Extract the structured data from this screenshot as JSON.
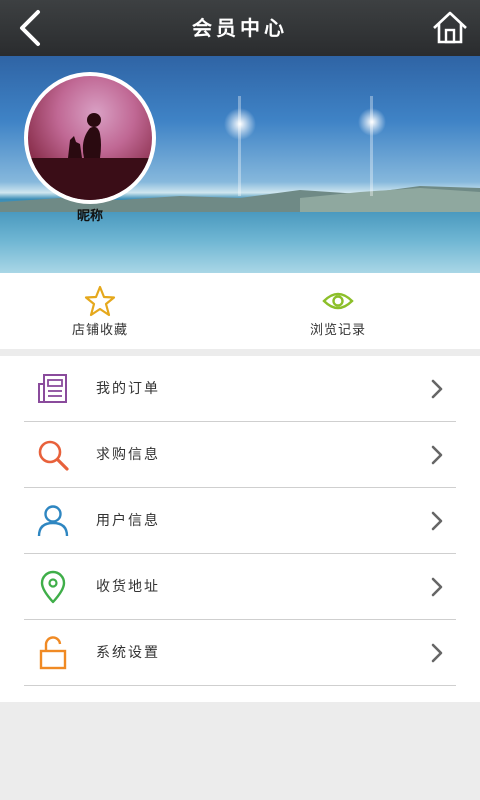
{
  "header": {
    "title": "会员中心",
    "back_icon": "chevron-left-icon",
    "home_icon": "home-icon"
  },
  "profile": {
    "nickname": "昵称"
  },
  "quick_actions": [
    {
      "label": "店铺收藏",
      "icon": "star-icon",
      "color": "#e5a81c"
    },
    {
      "label": "浏览记录",
      "icon": "eye-icon",
      "color": "#8cbf2a"
    }
  ],
  "menu": [
    {
      "label": "我的订单",
      "icon": "newspaper-icon",
      "color": "#8a4b9c"
    },
    {
      "label": "求购信息",
      "icon": "magnifier-icon",
      "color": "#e8613b"
    },
    {
      "label": "用户信息",
      "icon": "user-icon",
      "color": "#2e86c1"
    },
    {
      "label": "收货地址",
      "icon": "location-pin-icon",
      "color": "#3fae49"
    },
    {
      "label": "系统设置",
      "icon": "unlock-icon",
      "color": "#f08a24"
    }
  ]
}
